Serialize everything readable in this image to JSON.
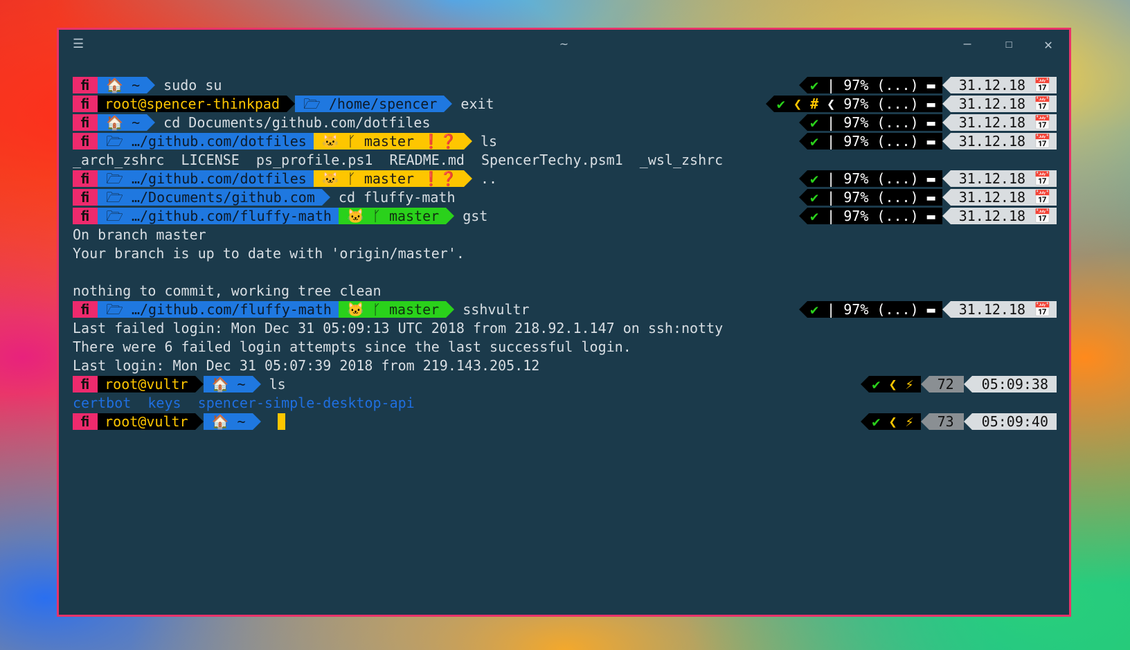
{
  "window": {
    "title": "~",
    "menu_icon": "hamburger-icon",
    "minimize": "—",
    "maximize": "☐",
    "close": "✕"
  },
  "glyphs": {
    "os": "ﬁ",
    "home": "🏠",
    "folder": "🗁",
    "cat": "🐱",
    "branch": "ᚴ",
    "bang": "❗",
    "question": "❓",
    "check": "✔",
    "chev": "❮",
    "bolt": "⚡",
    "battery": "▬",
    "calendar": "📅"
  },
  "lines": [
    {
      "prompt": {
        "path": "~",
        "command": "sudo su"
      }
    },
    {
      "prompt": {
        "user": "root@spencer-thinkpad",
        "path": "/home/spencer",
        "command": "exit"
      }
    },
    {
      "prompt": {
        "path": "~",
        "command": "cd Documents/github.com/dotfiles"
      }
    },
    {
      "prompt": {
        "path": "…/github.com/dotfiles",
        "branch": "master",
        "command": "ls"
      }
    },
    {
      "output": "_arch_zshrc  LICENSE  ps_profile.ps1  README.md  SpencerTechy.psm1  _wsl_zshrc"
    },
    {
      "prompt": {
        "path": "…/github.com/dotfiles",
        "branch": "master",
        "command": ".."
      }
    },
    {
      "prompt": {
        "path": "…/Documents/github.com",
        "command": "cd fluffy-math"
      }
    },
    {
      "prompt": {
        "path": "…/github.com/fluffy-math",
        "branch": "master",
        "command": "gst"
      }
    },
    {
      "output": "On branch master"
    },
    {
      "output": "Your branch is up to date with 'origin/master'."
    },
    {
      "output": ""
    },
    {
      "output": "nothing to commit, working tree clean"
    },
    {
      "prompt": {
        "path": "…/github.com/fluffy-math",
        "branch": "master",
        "command": "sshvultr"
      }
    },
    {
      "output": "Last failed login: Mon Dec 31 05:09:13 UTC 2018 from 218.92.1.147 on ssh:notty"
    },
    {
      "output": "There were 6 failed login attempts since the last successful login."
    },
    {
      "output": "Last login: Mon Dec 31 05:07:39 2018 from 219.143.205.12"
    },
    {
      "prompt": {
        "user": "root@vultr",
        "path": "~",
        "command": "ls"
      }
    },
    {
      "ls_dirs": [
        "certbot",
        "keys",
        "spencer-simple-desktop-api"
      ]
    },
    {
      "prompt": {
        "user": "root@vultr",
        "path": "~",
        "command": ""
      }
    }
  ],
  "right_prompts": {
    "battery": "97%",
    "load": "(...)",
    "date": "31.12.18",
    "root_hash": "#",
    "vultr": [
      {
        "num": "72",
        "time": "05:09:38"
      },
      {
        "num": "73",
        "time": "05:09:40"
      }
    ]
  },
  "colors": {
    "background": "#1b3a4b",
    "os_segment": "#ee2a6d",
    "path_segment": "#1f78e0",
    "git_dirty": "#fec600",
    "git_clean": "#2ad11b",
    "window_border": "#e8336a"
  }
}
